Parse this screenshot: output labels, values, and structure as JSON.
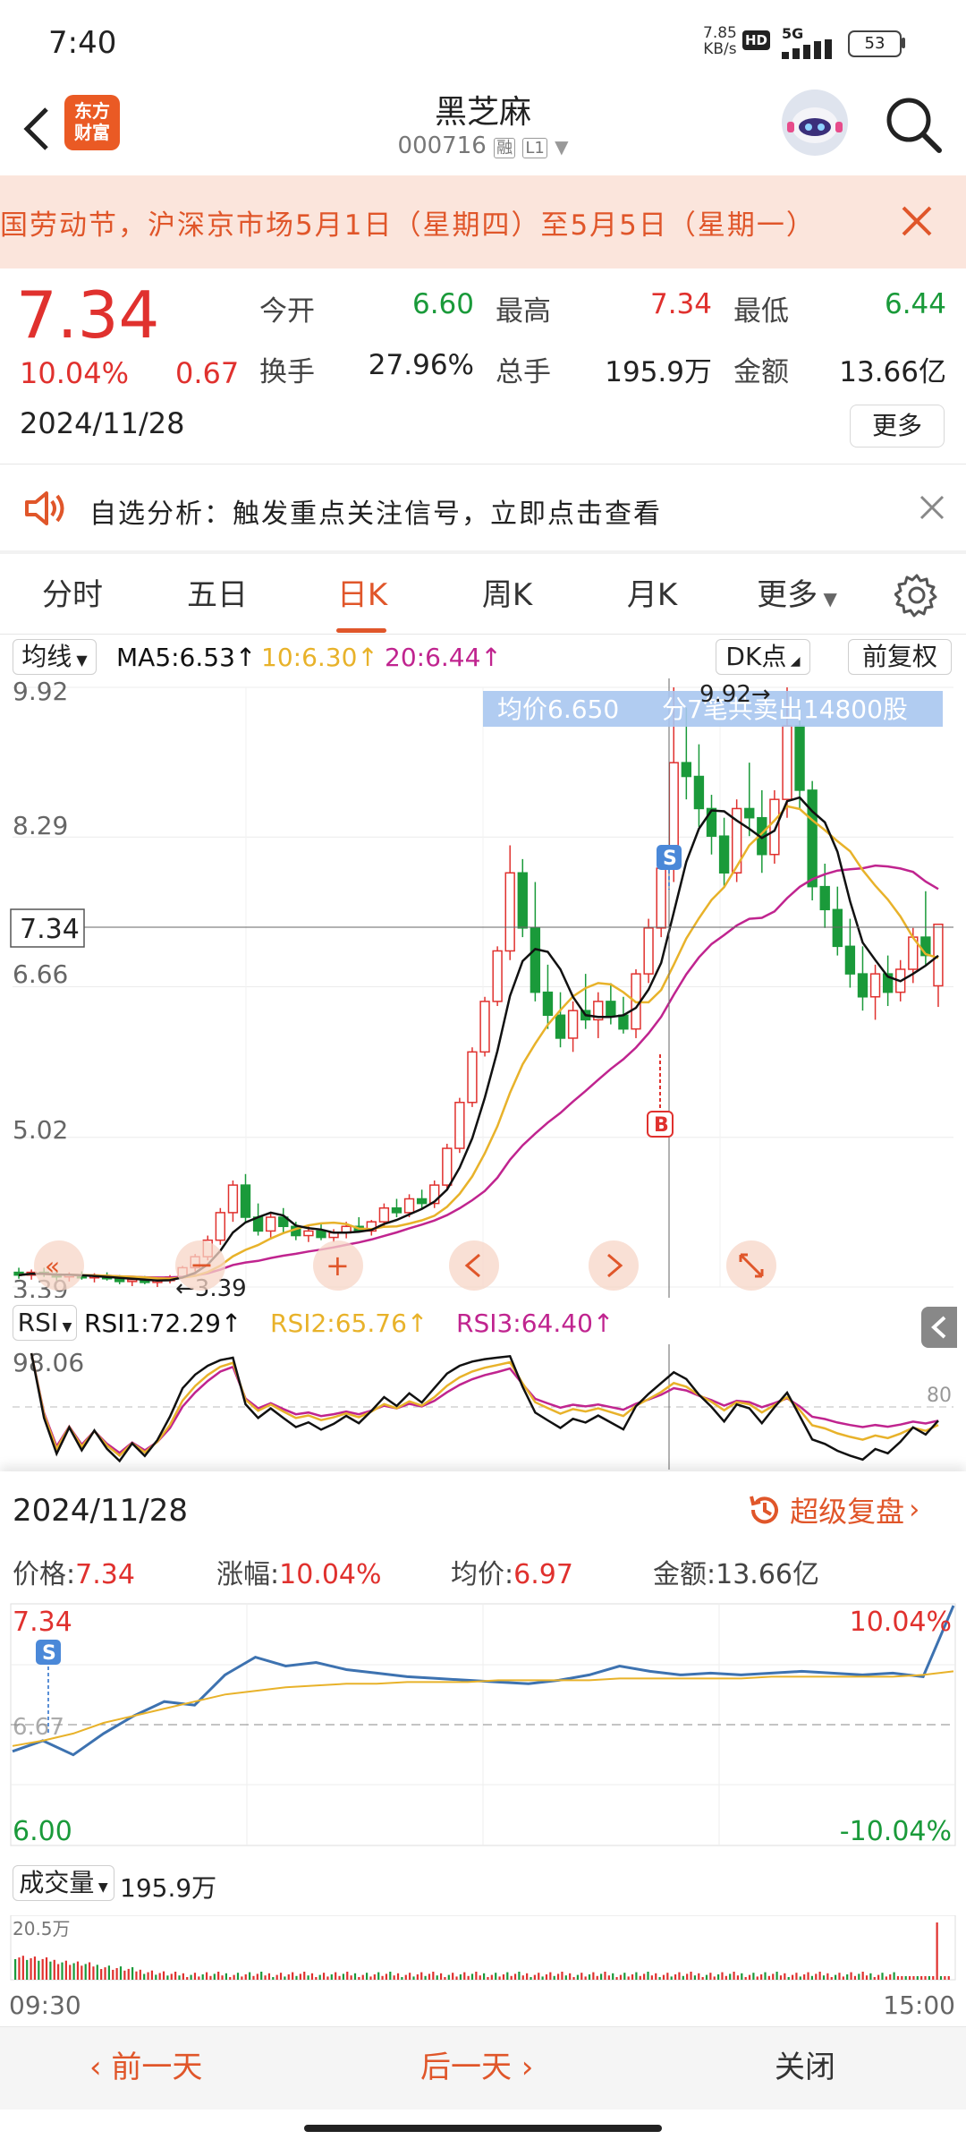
{
  "status_bar": {
    "time": "7:40",
    "net_speed": "7.85",
    "net_unit": "KB/s",
    "hd": "HD",
    "network": "5G",
    "battery": "53"
  },
  "header": {
    "logo_line1": "东方",
    "logo_line2": "财富",
    "title": "黑芝麻",
    "code": "000716",
    "tag1": "融",
    "tag2": "L1"
  },
  "notice": {
    "text": "国劳动节，沪深京市场5月1日（星期四）至5月5日（星期一）"
  },
  "quote": {
    "price": "7.34",
    "change_pct": "10.04%",
    "change": "0.67",
    "date": "2024/11/28",
    "open_label": "今开",
    "open": "6.60",
    "high_label": "最高",
    "high": "7.34",
    "low_label": "最低",
    "low": "6.44",
    "turnover_label": "换手",
    "turnover": "27.96%",
    "volume_label": "总手",
    "volume": "195.9万",
    "amount_label": "金额",
    "amount": "13.66亿",
    "more_label": "更多"
  },
  "analysis": {
    "text": "自选分析：触发重点关注信号，立即点击查看"
  },
  "tabs": [
    {
      "label": "分时"
    },
    {
      "label": "五日"
    },
    {
      "label": "日K"
    },
    {
      "label": "周K"
    },
    {
      "label": "月K"
    },
    {
      "label": "更多"
    }
  ],
  "kline": {
    "indicator_label": "均线",
    "ma5": "MA5:6.53",
    "ma10": "10:6.30",
    "ma20": "20:6.44",
    "dk_label": "DK点",
    "adjust_label": "前复权",
    "y_labels": [
      "9.92",
      "8.29",
      "7.34",
      "6.66",
      "5.02",
      "3.39"
    ],
    "tooltip_avg": "均价6.650",
    "tooltip_trade": "分7笔共卖出14800股",
    "max_label": "9.92",
    "min_label": "3.39",
    "s_marker": "S",
    "b_marker": "B"
  },
  "rsi": {
    "label": "RSI",
    "rsi1": "RSI1:72.29",
    "rsi2": "RSI2:65.76",
    "rsi3": "RSI3:64.40",
    "top_label": "98.06",
    "line_label": "80"
  },
  "intraday": {
    "date": "2024/11/28",
    "replay_label": "超级复盘",
    "price_label": "价格:",
    "price": "7.34",
    "pct_label": "涨幅:",
    "pct": "10.04%",
    "avg_label": "均价:",
    "avg": "6.97",
    "amount_label": "金额:",
    "amount": "13.66亿",
    "y_top": "7.34",
    "y_mid": "6.67",
    "y_bottom": "6.00",
    "pct_top": "10.04%",
    "pct_bottom": "-10.04%",
    "s_marker": "S",
    "vol_label": "成交量",
    "vol_value": "195.9万",
    "vol_max": "20.5万",
    "time_start": "09:30",
    "time_end": "15:00"
  },
  "bottom": {
    "prev": "前一天",
    "next": "后一天",
    "close": "关闭"
  },
  "colors": {
    "up": "#e0312e",
    "down": "#1a9a3a",
    "accent": "#e0562a",
    "ma5": "#111111",
    "ma10": "#e8b22a",
    "ma20": "#c0248f",
    "intraday_price": "#3d72b0",
    "intraday_avg": "#e8b22a"
  },
  "chart_data": [
    {
      "type": "candlestick",
      "title": "日K",
      "ylim": [
        3.39,
        9.92
      ],
      "y_ticks": [
        9.92,
        8.29,
        6.66,
        5.02,
        3.39
      ],
      "current_price_line": 7.34,
      "candles": [
        [
          3.55,
          3.6,
          3.48,
          3.52
        ],
        [
          3.52,
          3.58,
          3.47,
          3.55
        ],
        [
          3.55,
          3.6,
          3.5,
          3.53
        ],
        [
          3.53,
          3.57,
          3.46,
          3.5
        ],
        [
          3.5,
          3.55,
          3.45,
          3.52
        ],
        [
          3.52,
          3.56,
          3.47,
          3.49
        ],
        [
          3.49,
          3.54,
          3.44,
          3.51
        ],
        [
          3.51,
          3.55,
          3.46,
          3.48
        ],
        [
          3.48,
          3.52,
          3.42,
          3.45
        ],
        [
          3.45,
          3.5,
          3.4,
          3.47
        ],
        [
          3.47,
          3.51,
          3.42,
          3.44
        ],
        [
          3.44,
          3.48,
          3.39,
          3.46
        ],
        [
          3.46,
          3.52,
          3.43,
          3.5
        ],
        [
          3.5,
          3.62,
          3.48,
          3.6
        ],
        [
          3.6,
          3.75,
          3.56,
          3.72
        ],
        [
          3.72,
          3.95,
          3.68,
          3.9
        ],
        [
          3.9,
          4.25,
          3.85,
          4.2
        ],
        [
          4.2,
          4.55,
          4.1,
          4.5
        ],
        [
          4.5,
          4.62,
          4.1,
          4.15
        ],
        [
          4.15,
          4.3,
          3.95,
          4.0
        ],
        [
          4.0,
          4.2,
          3.92,
          4.15
        ],
        [
          4.15,
          4.25,
          3.98,
          4.05
        ],
        [
          4.05,
          4.1,
          3.9,
          3.95
        ],
        [
          3.95,
          4.05,
          3.88,
          4.0
        ],
        [
          4.0,
          4.08,
          3.9,
          3.93
        ],
        [
          3.93,
          4.02,
          3.88,
          3.98
        ],
        [
          3.98,
          4.1,
          3.92,
          4.05
        ],
        [
          4.05,
          4.15,
          3.98,
          4.0
        ],
        [
          4.0,
          4.12,
          3.95,
          4.1
        ],
        [
          4.1,
          4.3,
          4.05,
          4.25
        ],
        [
          4.25,
          4.35,
          4.15,
          4.2
        ],
        [
          4.2,
          4.4,
          4.15,
          4.35
        ],
        [
          4.35,
          4.45,
          4.25,
          4.3
        ],
        [
          4.3,
          4.55,
          4.25,
          4.5
        ],
        [
          4.5,
          4.95,
          4.45,
          4.9
        ],
        [
          4.9,
          5.45,
          4.85,
          5.4
        ],
        [
          5.4,
          6.0,
          5.35,
          5.95
        ],
        [
          5.95,
          6.55,
          5.9,
          6.5
        ],
        [
          6.5,
          7.1,
          6.45,
          7.05
        ],
        [
          7.05,
          8.2,
          6.95,
          7.9
        ],
        [
          7.9,
          8.05,
          7.2,
          7.3
        ],
        [
          7.3,
          7.8,
          6.5,
          6.6
        ],
        [
          6.6,
          6.9,
          6.2,
          6.35
        ],
        [
          6.35,
          6.6,
          6.0,
          6.1
        ],
        [
          6.1,
          6.5,
          5.95,
          6.4
        ],
        [
          6.4,
          6.8,
          6.2,
          6.3
        ],
        [
          6.3,
          6.6,
          6.1,
          6.5
        ],
        [
          6.5,
          6.7,
          6.25,
          6.35
        ],
        [
          6.35,
          6.55,
          6.15,
          6.2
        ],
        [
          6.2,
          6.85,
          6.1,
          6.8
        ],
        [
          6.8,
          7.4,
          6.7,
          7.3
        ],
        [
          7.3,
          8.05,
          7.2,
          7.95
        ],
        [
          7.95,
          9.92,
          7.8,
          9.1
        ],
        [
          9.1,
          9.7,
          8.7,
          8.95
        ],
        [
          8.95,
          9.3,
          8.4,
          8.6
        ],
        [
          8.6,
          8.75,
          8.1,
          8.3
        ],
        [
          8.3,
          8.5,
          7.75,
          7.9
        ],
        [
          7.9,
          8.7,
          7.8,
          8.6
        ],
        [
          8.6,
          9.1,
          8.3,
          8.5
        ],
        [
          8.5,
          8.8,
          7.9,
          8.1
        ],
        [
          8.1,
          8.8,
          8.0,
          8.7
        ],
        [
          8.7,
          9.92,
          8.5,
          9.5
        ],
        [
          9.5,
          9.7,
          8.6,
          8.8
        ],
        [
          8.8,
          8.9,
          7.6,
          7.75
        ],
        [
          7.75,
          8.0,
          7.3,
          7.5
        ],
        [
          7.5,
          7.75,
          7.0,
          7.1
        ],
        [
          7.1,
          7.4,
          6.65,
          6.8
        ],
        [
          6.8,
          7.1,
          6.4,
          6.55
        ],
        [
          6.55,
          6.9,
          6.3,
          6.8
        ],
        [
          6.8,
          7.0,
          6.45,
          6.6
        ],
        [
          6.6,
          6.95,
          6.5,
          6.85
        ],
        [
          6.85,
          7.3,
          6.7,
          7.2
        ],
        [
          7.2,
          7.7,
          6.9,
          7.0
        ],
        [
          6.67,
          7.34,
          6.44,
          7.34
        ]
      ]
    },
    {
      "type": "line",
      "title": "RSI",
      "series": [
        {
          "name": "RSI1",
          "last": 72.29
        },
        {
          "name": "RSI2",
          "last": 65.76
        },
        {
          "name": "RSI3",
          "last": 64.4
        }
      ],
      "reference_line": 80,
      "top_label": 98.06
    },
    {
      "type": "line",
      "title": "分时",
      "ylim": [
        6.0,
        7.34
      ],
      "pct_range": [
        "-10.04%",
        "10.04%"
      ],
      "series": [
        {
          "name": "价格",
          "values": [
            6.52,
            6.58,
            6.5,
            6.62,
            6.72,
            6.8,
            6.78,
            6.95,
            7.05,
            7.0,
            7.02,
            6.98,
            6.96,
            6.94,
            6.93,
            6.92,
            6.91,
            6.9,
            6.92,
            6.95,
            7.0,
            6.97,
            6.95,
            6.96,
            6.95,
            6.96,
            6.97,
            6.96,
            6.95,
            6.96,
            6.94,
            7.34
          ]
        },
        {
          "name": "均价",
          "values": [
            6.55,
            6.58,
            6.62,
            6.68,
            6.72,
            6.76,
            6.8,
            6.84,
            6.86,
            6.88,
            6.89,
            6.9,
            6.9,
            6.91,
            6.91,
            6.91,
            6.92,
            6.92,
            6.92,
            6.92,
            6.93,
            6.93,
            6.93,
            6.93,
            6.93,
            6.94,
            6.94,
            6.94,
            6.94,
            6.94,
            6.95,
            6.97
          ]
        }
      ],
      "x_labels": [
        "09:30",
        "15:00"
      ]
    },
    {
      "type": "bar",
      "title": "成交量",
      "total": "195.9万",
      "max_label": "20.5万"
    }
  ]
}
